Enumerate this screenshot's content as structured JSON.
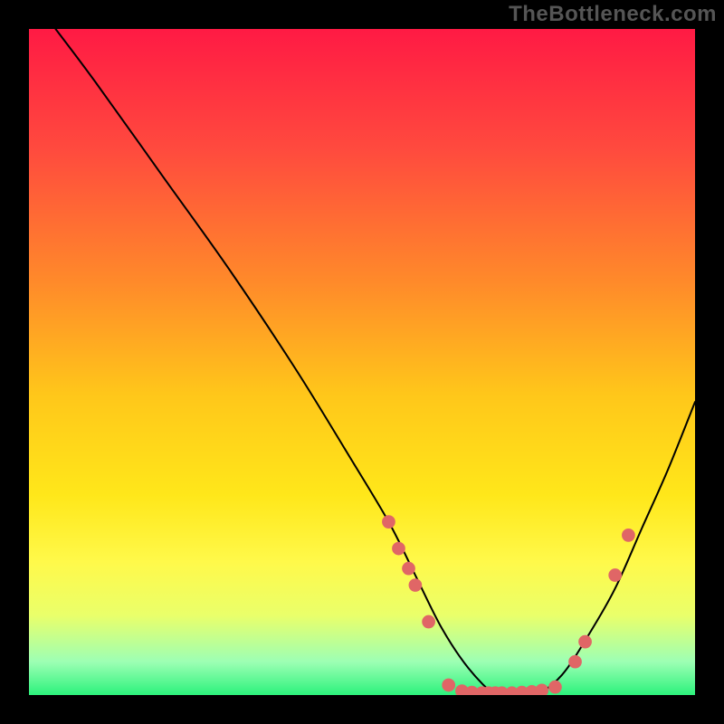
{
  "watermark": "TheBottleneck.com",
  "chart_data": {
    "type": "line",
    "title": "",
    "xlabel": "",
    "ylabel": "",
    "xlim": [
      0,
      100
    ],
    "ylim": [
      0,
      100
    ],
    "series": [
      {
        "name": "curve",
        "x": [
          4,
          10,
          20,
          30,
          40,
          48,
          54,
          58,
          62,
          66,
          70,
          72,
          76,
          80,
          84,
          88,
          92,
          96,
          100
        ],
        "y": [
          100,
          92,
          78,
          64,
          49,
          36,
          26,
          18,
          10,
          4,
          0,
          0,
          0,
          3,
          9,
          16,
          25,
          34,
          44
        ]
      }
    ],
    "markers": {
      "color": "#e06666",
      "radius": 1.0,
      "points": [
        {
          "x": 54,
          "y": 26
        },
        {
          "x": 55.5,
          "y": 22
        },
        {
          "x": 57,
          "y": 19
        },
        {
          "x": 58,
          "y": 16.5
        },
        {
          "x": 60,
          "y": 11
        },
        {
          "x": 63,
          "y": 1.5
        },
        {
          "x": 65,
          "y": 0.6
        },
        {
          "x": 66.5,
          "y": 0.4
        },
        {
          "x": 68,
          "y": 0.3
        },
        {
          "x": 69,
          "y": 0.3
        },
        {
          "x": 70,
          "y": 0.3
        },
        {
          "x": 71,
          "y": 0.3
        },
        {
          "x": 72.5,
          "y": 0.3
        },
        {
          "x": 74,
          "y": 0.4
        },
        {
          "x": 75.5,
          "y": 0.5
        },
        {
          "x": 77,
          "y": 0.7
        },
        {
          "x": 79,
          "y": 1.2
        },
        {
          "x": 82,
          "y": 5
        },
        {
          "x": 83.5,
          "y": 8
        },
        {
          "x": 88,
          "y": 18
        },
        {
          "x": 90,
          "y": 24
        }
      ]
    },
    "background_gradient": {
      "top": "#ff1a44",
      "bottom": "#2cf27c"
    }
  }
}
